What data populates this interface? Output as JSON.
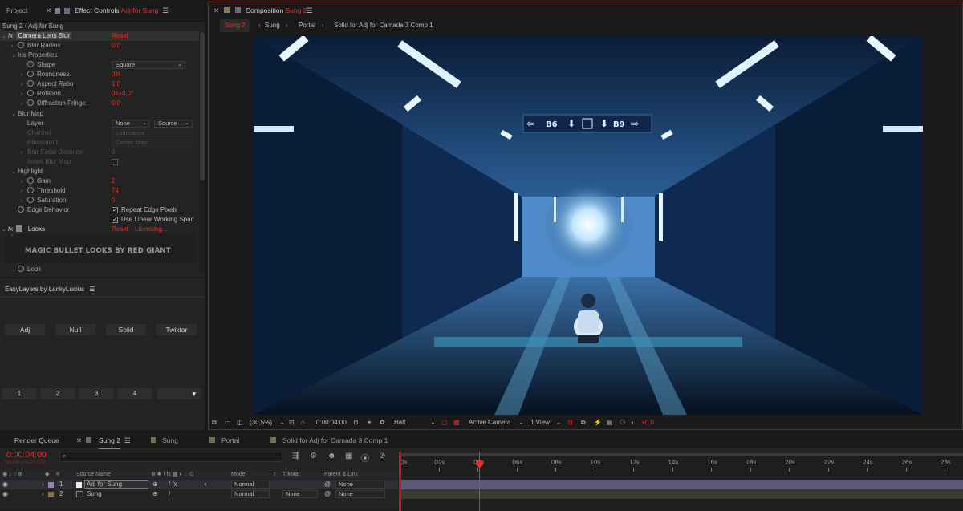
{
  "left_top": {
    "tab_project": "Project",
    "tab_effect_controls": "Effect Controls",
    "tab_effect_layer": "Adj for Sung",
    "breadcrumb": "Sung 2 • Adj for Sung"
  },
  "effect": {
    "name": "Camera Lens Blur",
    "reset": "Reset",
    "blur_radius_label": "Blur Radius",
    "blur_radius": "0,0",
    "iris_label": "Iris Properties",
    "shape_label": "Shape",
    "shape_value": "Square",
    "roundness_label": "Roundness",
    "roundness": "0%",
    "aspect_label": "Aspect Ratio",
    "aspect": "1,0",
    "rotation_label": "Rotation",
    "rotation": "0x+0,0°",
    "diffraction_label": "Diffraction Fringe",
    "diffraction": "0,0",
    "blurmap_label": "Blur Map",
    "layer_label": "Layer",
    "layer_value": "None",
    "layer_source": "Source",
    "channel_label": "Channel",
    "channel_value": "Luminance",
    "placement_label": "Placement",
    "placement_value": "Center Map",
    "focal_label": "Blur Focal Distance",
    "focal_value": "0",
    "invert_label": "Invert Blur Map",
    "highlight_label": "Highlight",
    "gain_label": "Gain",
    "gain": "2",
    "threshold_label": "Threshold",
    "threshold": "74",
    "saturation_label": "Saturation",
    "saturation": "0",
    "edge_label": "Edge Behavior",
    "repeat_edge": "Repeat Edge Pixels",
    "linear": "Use Linear Working Spac"
  },
  "looks": {
    "name": "Looks",
    "reset": "Reset",
    "licensing": "Licensing...",
    "logo_text": "MAGIC BULLET LOOKS BY RED GIANT",
    "look_label": "Look"
  },
  "easylayers": {
    "title": "EasyLayers by LankyLucius",
    "buttons": [
      "Adj",
      "Null",
      "Solid",
      "Twixtor"
    ],
    "slots": [
      "1",
      "2",
      "3",
      "4"
    ]
  },
  "composition": {
    "tab_label": "Composition",
    "tab_name": "Sung 2",
    "crumbs": [
      "Sung 2",
      "Sung",
      "Portal",
      "Solid for Adj for Camada 3 Comp 1"
    ],
    "zoom": "(30,5%)",
    "timecode": "0:00:04:00",
    "resolution": "Half",
    "camera": "Active Camera",
    "view": "1 View",
    "exposure": "+0,0",
    "sign_left": "B6",
    "sign_right": "B9"
  },
  "timeline": {
    "tabs": [
      "Render Queue",
      "Sung 2",
      "Sung",
      "Portal",
      "Solid for Adj for Camada 3 Comp 1"
    ],
    "timecode": "0:00:04:00",
    "frames": "00096 (24.00 fps)",
    "search_placeholder": "",
    "col_source": "Source Name",
    "col_mode": "Mode",
    "col_t": "T",
    "col_trkmat": "TrkMat",
    "col_parent": "Parent & Link",
    "ticks": [
      "0s",
      "02s",
      "04s",
      "06s",
      "08s",
      "10s",
      "12s",
      "14s",
      "16s",
      "18s",
      "20s",
      "22s",
      "24s",
      "26s",
      "28s"
    ],
    "layers": [
      {
        "num": "1",
        "name": "Adj for Sung",
        "mode": "Normal",
        "trkmat": "",
        "parent": "None"
      },
      {
        "num": "2",
        "name": "Sung",
        "mode": "Normal",
        "trkmat": "None",
        "parent": "None"
      }
    ]
  },
  "colors": {
    "accent": "#e6302a",
    "panel": "#232323",
    "bar_blue": "#5a5a78"
  }
}
